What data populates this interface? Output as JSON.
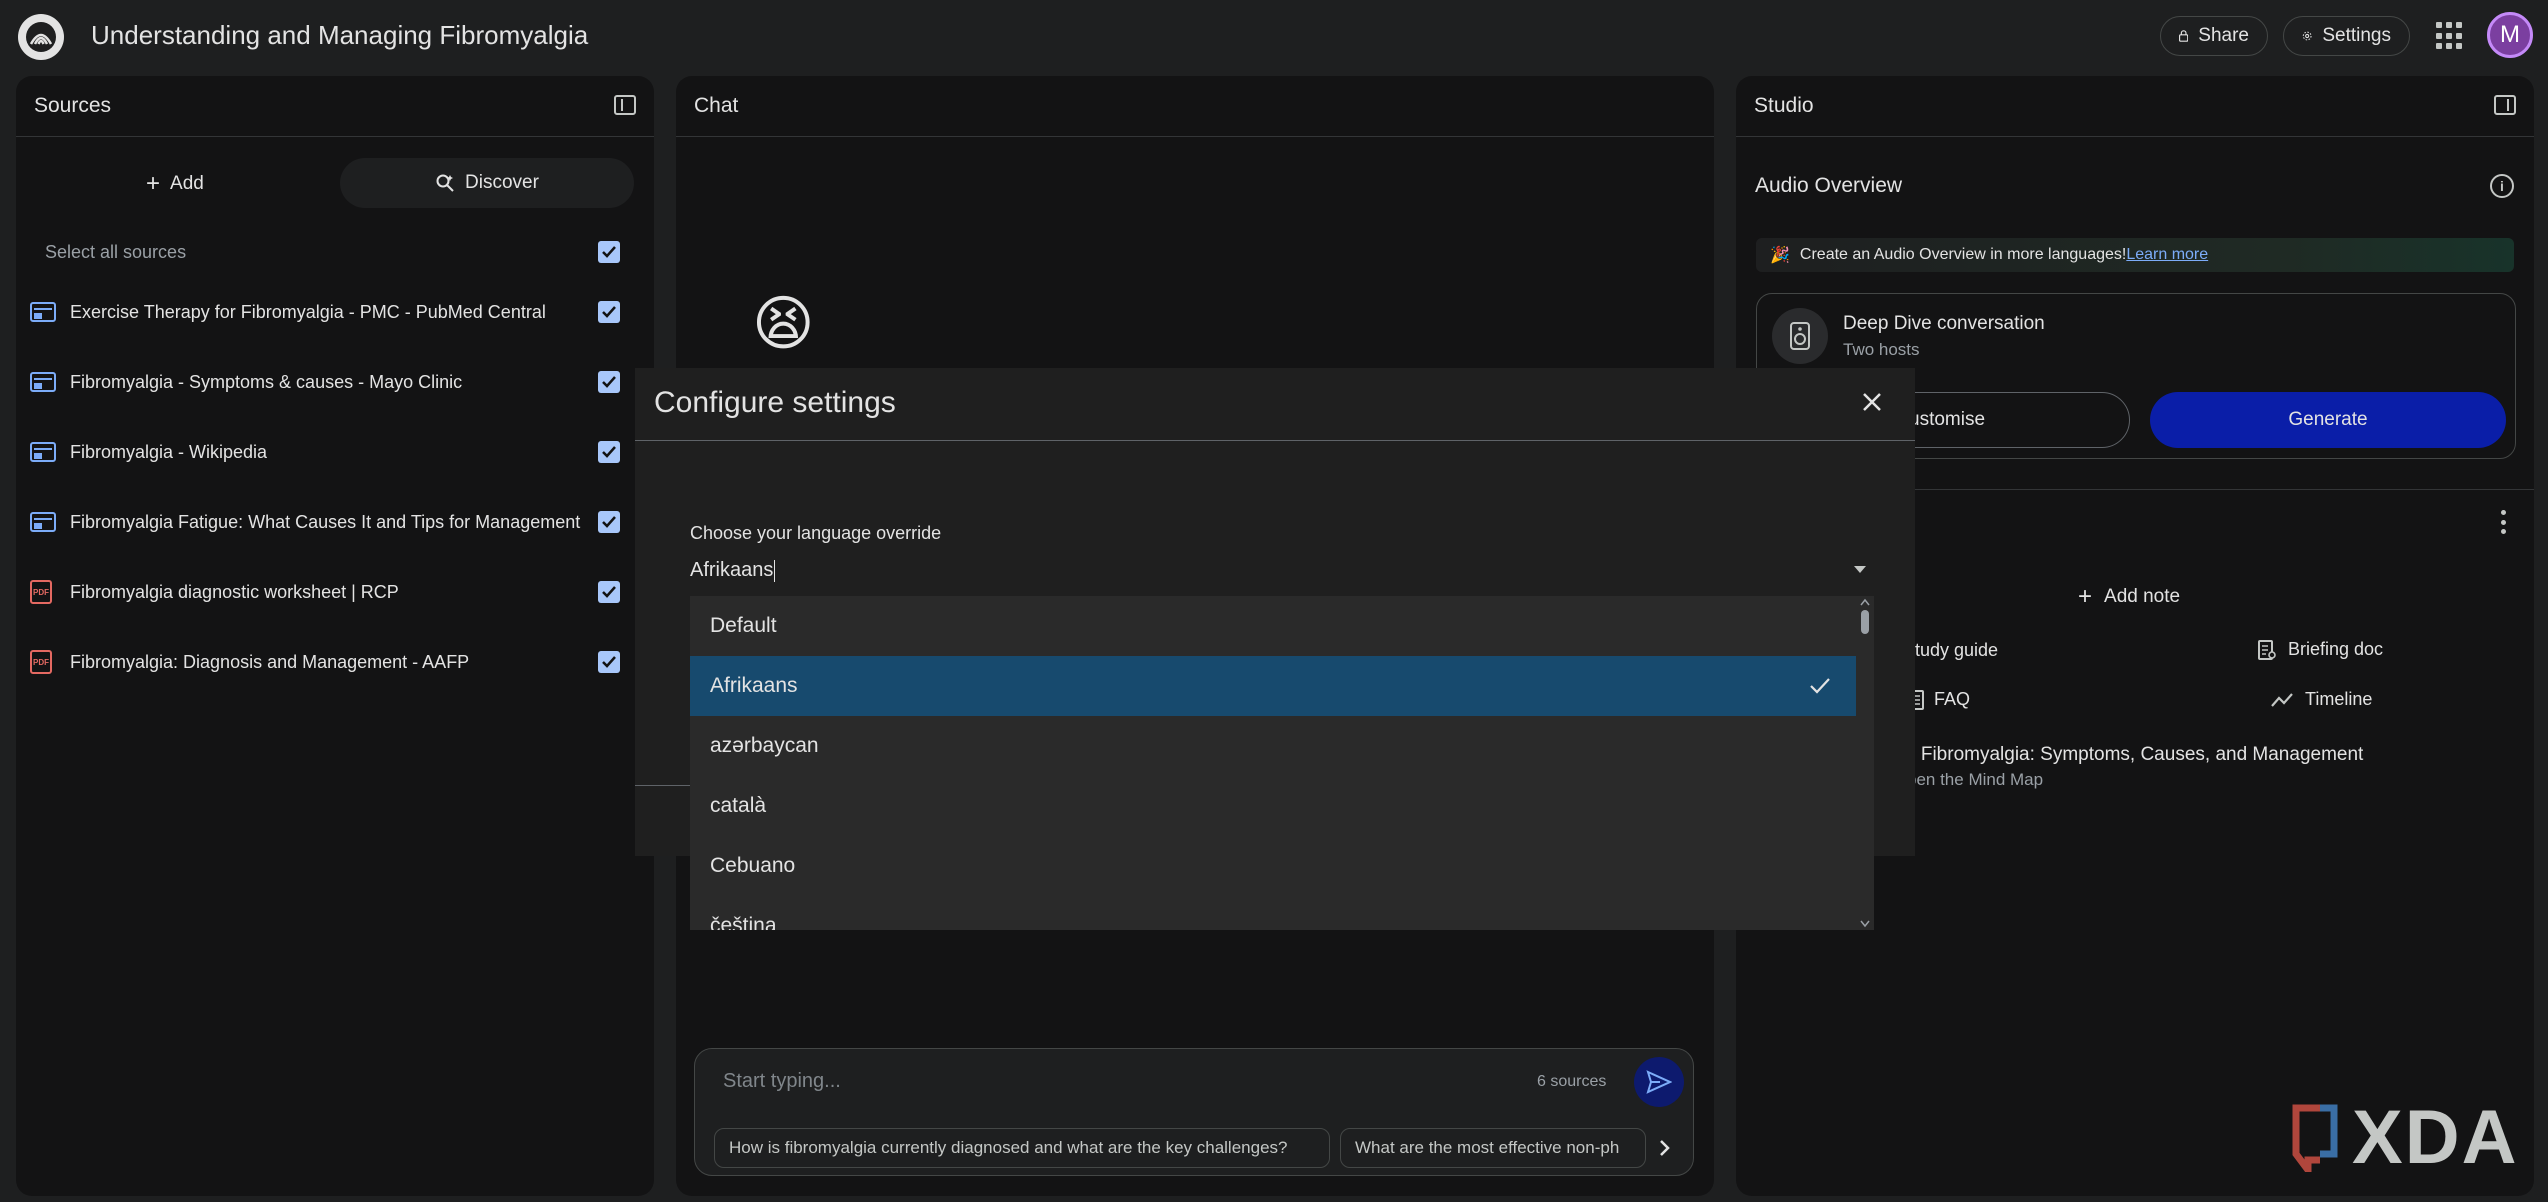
{
  "app": {
    "title": "Understanding and Managing Fibromyalgia",
    "share_label": "Share",
    "settings_label": "Settings",
    "avatar_initial": "M"
  },
  "sources": {
    "header": "Sources",
    "add_label": "Add",
    "discover_label": "Discover",
    "select_all_label": "Select all sources",
    "items": [
      {
        "label": "Exercise Therapy for Fibromyalgia - PMC - PubMed Central",
        "type": "web"
      },
      {
        "label": "Fibromyalgia - Symptoms & causes - Mayo Clinic",
        "type": "web"
      },
      {
        "label": "Fibromyalgia - Wikipedia",
        "type": "web"
      },
      {
        "label": "Fibromyalgia Fatigue: What Causes It and Tips for Management",
        "type": "web"
      },
      {
        "label": "Fibromyalgia diagnostic worksheet | RCP",
        "type": "pdf"
      },
      {
        "label": "Fibromyalgia: Diagnosis and Management - AAFP",
        "type": "pdf"
      }
    ]
  },
  "chat": {
    "header": "Chat",
    "emoji": "😫",
    "input_placeholder": "Start typing...",
    "source_count": "6 sources",
    "suggestions": [
      "How is fibromyalgia currently diagnosed and what are the key challenges?",
      "What are the most effective non-ph"
    ]
  },
  "studio": {
    "header": "Studio",
    "audio_overview_title": "Audio Overview",
    "banner_text": "Create an Audio Overview in more languages!",
    "banner_link": "Learn more",
    "deep_dive_title": "Deep Dive conversation",
    "deep_dive_subtitle": "Two hosts",
    "customise_label": "ustomise",
    "generate_label": "Generate",
    "add_note_label": "Add note",
    "study_guide_label": "tudy guide",
    "briefing_doc_label": "Briefing doc",
    "faq_label": "FAQ",
    "timeline_label": "Timeline",
    "mindmap_title": "g Fibromyalgia: Symptoms, Causes, and Management",
    "mindmap_subtitle": "pen the Mind Map"
  },
  "modal": {
    "title": "Configure settings",
    "language_label": "Choose your language override",
    "language_value": "Afrikaans",
    "options": [
      "Default",
      "Afrikaans",
      "azərbaycan",
      "català",
      "Cebuano",
      "čeština"
    ],
    "selected_index": 1
  },
  "watermark": "XDA",
  "colors": {
    "background": "#1e1f20",
    "panel": "#131314",
    "selected_option": "#174a6e",
    "generate_button": "#0a1ea8",
    "checkbox": "#a8c7fa"
  }
}
